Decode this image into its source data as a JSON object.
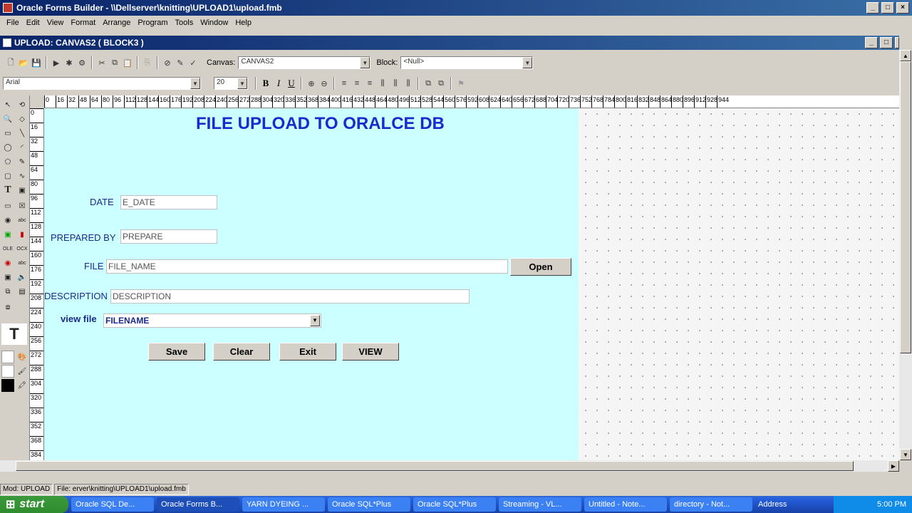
{
  "window": {
    "title": "Oracle Forms Builder - \\\\Dellserver\\knitting\\UPLOAD1\\upload.fmb"
  },
  "menu": [
    "File",
    "Edit",
    "View",
    "Format",
    "Arrange",
    "Program",
    "Tools",
    "Window",
    "Help"
  ],
  "inner_window": {
    "title": "UPLOAD: CANVAS2 ( BLOCK3 )"
  },
  "toolbar": {
    "canvas_label": "Canvas:",
    "canvas_value": "CANVAS2",
    "block_label": "Block:",
    "block_value": "<Null>",
    "font_value": "Arial",
    "font_size": "20",
    "bold": "B",
    "italic": "I",
    "underline": "U"
  },
  "ruler_h": [
    "0",
    "16",
    "32",
    "48",
    "64",
    "80",
    "96",
    "112",
    "128",
    "144",
    "160",
    "176",
    "192",
    "208",
    "224",
    "240",
    "256",
    "272",
    "288",
    "304",
    "320",
    "336",
    "352",
    "368",
    "384",
    "400",
    "416",
    "432",
    "448",
    "464",
    "480",
    "496",
    "512",
    "528",
    "544",
    "560",
    "576",
    "592",
    "608",
    "624",
    "640",
    "656",
    "672",
    "688",
    "704",
    "720",
    "736",
    "752",
    "768",
    "784",
    "800",
    "816",
    "832",
    "848",
    "864",
    "880",
    "896",
    "912",
    "928",
    "944"
  ],
  "ruler_v": [
    "0",
    "16",
    "32",
    "48",
    "64",
    "80",
    "96",
    "112",
    "128",
    "144",
    "160",
    "176",
    "192",
    "208",
    "224",
    "240",
    "256",
    "272",
    "288",
    "304",
    "320",
    "336",
    "352",
    "368",
    "384"
  ],
  "form": {
    "heading": "FILE UPLOAD TO ORALCE DB",
    "date_label": "DATE",
    "date_value": "E_DATE",
    "prepared_label": "PREPARED BY",
    "prepared_value": "PREPARE",
    "file_label": "FILE",
    "file_value": "FILE_NAME",
    "open_button": "Open",
    "desc_label": "DESCRIPTION",
    "desc_value": "DESCRIPTION",
    "view_label": "view file",
    "view_value": "FILENAME",
    "buttons": {
      "save": "Save",
      "clear": "Clear",
      "exit": "Exit",
      "view": "VIEW"
    }
  },
  "status": {
    "mod": "Mod: UPLOAD",
    "file": "File: erver\\knitting\\UPLOAD1\\upload.fmb"
  },
  "taskbar": {
    "start": "start",
    "tasks": [
      "Oracle SQL De...",
      "Oracle Forms B...",
      "YARN DYEING ...",
      "Oracle SQL*Plus",
      "Oracle SQL*Plus",
      "Streaming - VL...",
      "Untitled - Note...",
      "directory - Not..."
    ],
    "address": "Address",
    "clock": "5:00 PM"
  },
  "colors": {
    "canvas_bg": "#ccffff",
    "heading": "#1a2acc",
    "titlebar": "#0a246a"
  }
}
